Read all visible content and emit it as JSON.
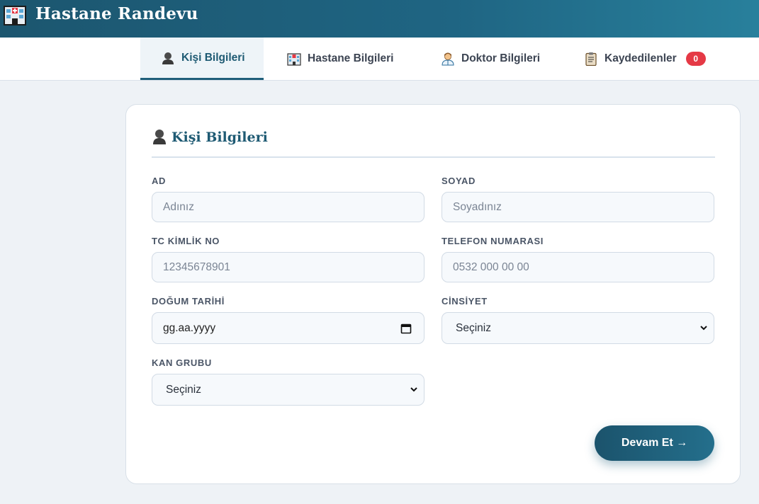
{
  "app": {
    "title": "Hastane Randevu"
  },
  "tabs": [
    {
      "label": "Kişi Bilgileri",
      "active": true,
      "icon": "person-icon"
    },
    {
      "label": "Hastane Bilgileri",
      "active": false,
      "icon": "hospital-icon"
    },
    {
      "label": "Doktor Bilgileri",
      "active": false,
      "icon": "doctor-icon"
    },
    {
      "label": "Kaydedilenler",
      "active": false,
      "icon": "clipboard-icon",
      "badge": "0"
    }
  ],
  "form": {
    "title": "Kişi Bilgileri",
    "fields": {
      "ad": {
        "label": "AD",
        "placeholder": "Adınız",
        "value": ""
      },
      "soyad": {
        "label": "SOYAD",
        "placeholder": "Soyadınız",
        "value": ""
      },
      "tc": {
        "label": "TC KİMLİK NO",
        "placeholder": "12345678901",
        "value": ""
      },
      "telefon": {
        "label": "TELEFON NUMARASI",
        "placeholder": "0532 000 00 00",
        "value": ""
      },
      "dogum": {
        "label": "DOĞUM TARİHİ",
        "placeholder": "gg.aa.yyyy"
      },
      "cinsiyet": {
        "label": "CİNSİYET",
        "selected": "Seçiniz"
      },
      "kan": {
        "label": "KAN GRUBU",
        "selected": "Seçiniz"
      }
    },
    "submit_label": "Devam Et →"
  },
  "colors": {
    "accent": "#1f5f7a",
    "badge": "#e53945",
    "background": "#eef2f6"
  }
}
